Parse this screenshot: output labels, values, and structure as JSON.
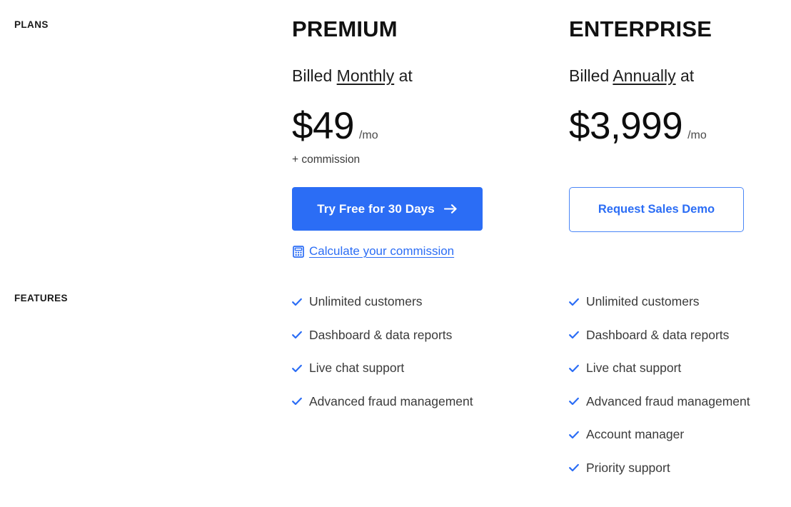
{
  "sections": {
    "plans_label": "PLANS",
    "features_label": "FEATURES"
  },
  "colors": {
    "primary_blue": "#2b6df5",
    "border_blue": "#4a86f7",
    "check_blue": "#2b6df5",
    "text_dark": "#111111",
    "text_body": "#3a3a3a"
  },
  "plans": [
    {
      "id": "premium",
      "title": "PREMIUM",
      "billing_prefix": "Billed ",
      "billing_cycle": "Monthly",
      "billing_suffix": " at",
      "price": "$49",
      "period": "/mo",
      "note": "+ commission",
      "cta": {
        "label": "Try Free for 30 Days",
        "icon": "arrow-right-icon",
        "style": "primary"
      },
      "secondary_link": {
        "label": "Calculate your commission",
        "icon": "calculator-icon"
      },
      "features": [
        "Unlimited customers",
        "Dashboard & data reports",
        "Live chat support",
        "Advanced fraud management"
      ]
    },
    {
      "id": "enterprise",
      "title": "ENTERPRISE",
      "billing_prefix": "Billed ",
      "billing_cycle": "Annually",
      "billing_suffix": " at",
      "price": "$3,999",
      "period": "/mo",
      "note": "",
      "cta": {
        "label": "Request Sales Demo",
        "icon": "",
        "style": "secondary"
      },
      "secondary_link": null,
      "features": [
        "Unlimited customers",
        "Dashboard & data reports",
        "Live chat support",
        "Advanced fraud management",
        "Account manager",
        "Priority support"
      ]
    }
  ]
}
